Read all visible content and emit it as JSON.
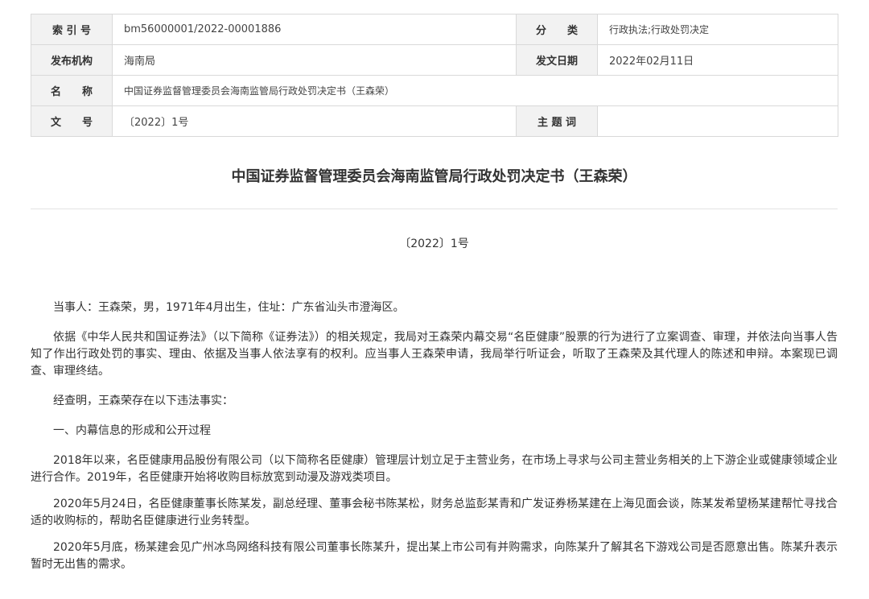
{
  "meta": {
    "index_label": "索 引 号",
    "index_value": "bm56000001/2022-00001886",
    "category_label": "分　　类",
    "category_value": "行政执法;行政处罚决定",
    "issuer_label": "发布机构",
    "issuer_value": "海南局",
    "date_label": "发文日期",
    "date_value": "2022年02月11日",
    "name_label": "名　　称",
    "name_value": "中国证券监督管理委员会海南监管局行政处罚决定书（王森荣）",
    "docno_label": "文　　号",
    "docno_value": "〔2022〕1号",
    "subject_label": "主 题 词",
    "subject_value": ""
  },
  "document": {
    "title": "中国证券监督管理委员会海南监管局行政处罚决定书（王森荣）",
    "number": "〔2022〕1号",
    "paragraphs": [
      "当事人：王森荣，男，1971年4月出生，住址：广东省汕头市澄海区。",
      "依据《中华人民共和国证券法》（以下简称《证券法》）的相关规定，我局对王森荣内幕交易“名臣健康”股票的行为进行了立案调查、审理，并依法向当事人告知了作出行政处罚的事实、理由、依据及当事人依法享有的权利。应当事人王森荣申请，我局举行听证会，听取了王森荣及其代理人的陈述和申辩。本案现已调查、审理终结。",
      "经查明，王森荣存在以下违法事实：",
      "一、内幕信息的形成和公开过程",
      "2018年以来，名臣健康用品股份有限公司（以下简称名臣健康）管理层计划立足于主营业务，在市场上寻求与公司主营业务相关的上下游企业或健康领域企业进行合作。2019年，名臣健康开始将收购目标放宽到动漫及游戏类项目。",
      "2020年5月24日，名臣健康董事长陈某发，副总经理、董事会秘书陈某松，财务总监彭某青和广发证券杨某建在上海见面会谈，陈某发希望杨某建帮忙寻找合适的收购标的，帮助名臣健康进行业务转型。",
      "2020年5月底，杨某建会见广州冰鸟网络科技有限公司董事长陈某升，提出某上市公司有并购需求，向陈某升了解其名下游戏公司是否愿意出售。陈某升表示暂时无出售的需求。"
    ]
  }
}
